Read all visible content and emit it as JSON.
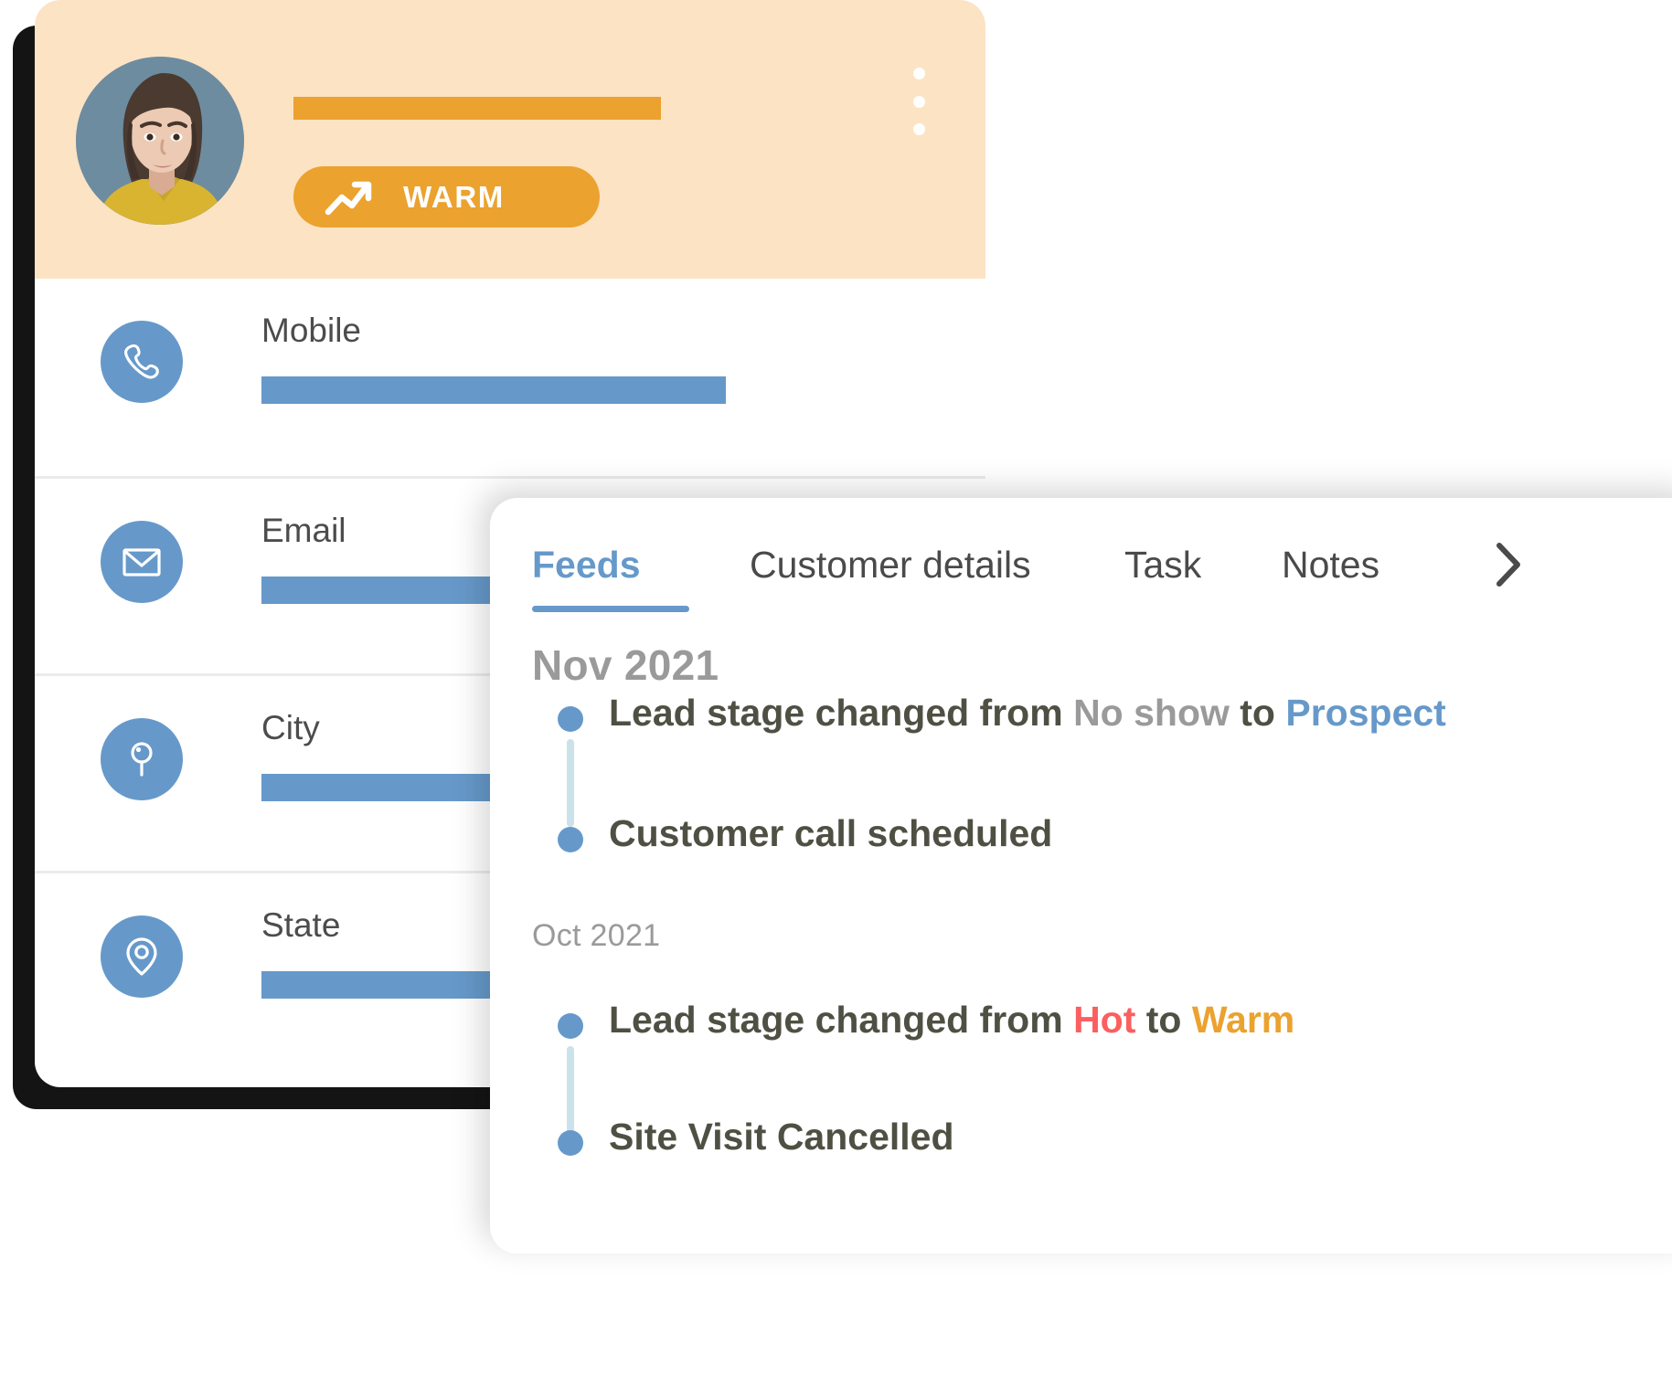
{
  "profile": {
    "header": {
      "background_color": "#FCE3C4",
      "name_placeholder_color": "#EBA22E",
      "avatar_alt": "customer-avatar",
      "badge": {
        "label": "WARM",
        "icon": "trending-up-icon",
        "background_color": "#EBA22E",
        "text_color": "#FFFFFF"
      },
      "menu_icon": "kebab-menu-icon"
    },
    "fields": [
      {
        "label": "Mobile",
        "icon": "phone-icon",
        "value_redacted": true,
        "bar_width_class": "w-mobile"
      },
      {
        "label": "Email",
        "icon": "envelope-icon",
        "value_redacted": true,
        "bar_width_class": "w-email"
      },
      {
        "label": "City",
        "icon": "pin-lollipop-icon",
        "value_redacted": true,
        "bar_width_class": "w-city"
      },
      {
        "label": "State",
        "icon": "map-pin-icon",
        "value_redacted": true,
        "bar_width_class": "w-state"
      }
    ],
    "icon_color": "#6699CA"
  },
  "feeds_panel": {
    "tabs": [
      {
        "label": "Feeds",
        "active": true
      },
      {
        "label": "Customer details",
        "active": false
      },
      {
        "label": "Task",
        "active": false
      },
      {
        "label": "Notes",
        "active": false
      }
    ],
    "next_tabs_icon": "chevron-right-icon",
    "active_tab_color": "#6699CA",
    "groups": [
      {
        "month": "Nov 2021",
        "emphasis": "primary",
        "entries": [
          {
            "segments": [
              {
                "text": "Lead stage changed from ",
                "style": "default"
              },
              {
                "text": "No show",
                "style": "muted"
              },
              {
                "text": " to ",
                "style": "default"
              },
              {
                "text": "Prospect",
                "style": "accent-blue"
              }
            ],
            "plain": "Lead stage changed from No show to Prospect",
            "has_connector": true
          },
          {
            "segments": [
              {
                "text": "Customer call scheduled",
                "style": "default"
              }
            ],
            "plain": "Customer call scheduled",
            "has_connector": false
          }
        ]
      },
      {
        "month": "Oct 2021",
        "emphasis": "secondary",
        "entries": [
          {
            "segments": [
              {
                "text": "Lead stage changed from ",
                "style": "default"
              },
              {
                "text": "Hot",
                "style": "accent-red"
              },
              {
                "text": " to ",
                "style": "default"
              },
              {
                "text": "Warm",
                "style": "accent-orange"
              }
            ],
            "plain": "Lead stage changed from Hot to Warm",
            "has_connector": true
          },
          {
            "segments": [
              {
                "text": "Site Visit Cancelled",
                "style": "default"
              }
            ],
            "plain": "Site Visit Cancelled",
            "has_connector": false
          }
        ]
      }
    ],
    "colors": {
      "bullet": "#6699CA",
      "connector": "#CBE2EA",
      "text": "#4F5043",
      "muted": "#9A9A9A",
      "hot": "#FB5F5F",
      "warm": "#EBA22E",
      "prospect": "#6699CA"
    }
  }
}
